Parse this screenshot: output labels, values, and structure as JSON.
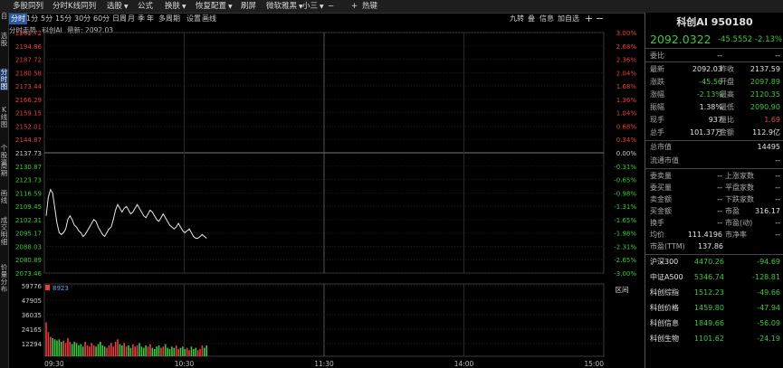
{
  "toolbar": {
    "items": [
      {
        "label": "多股同列",
        "caret": false
      },
      {
        "label": "分时K线同列",
        "caret": false
      },
      {
        "label": "选股",
        "caret": true
      },
      {
        "label": "公式",
        "caret": false
      },
      {
        "label": "换肤",
        "caret": true
      },
      {
        "label": "恢复配置",
        "caret": true
      },
      {
        "label": "刷屏",
        "caret": false
      },
      {
        "label": "微软雅黑",
        "caret": true
      },
      {
        "label": "小三",
        "caret": true
      },
      {
        "label": "热键",
        "caret": false
      }
    ],
    "minus": "−",
    "plus": "+"
  },
  "left_strip": [
    {
      "label": "自",
      "active": false
    },
    {
      "label": "选股",
      "active": false
    },
    {
      "label": "分时图",
      "active": true
    },
    {
      "label": "K线图",
      "active": false
    },
    {
      "label": "个股资",
      "active": false
    },
    {
      "label": "周期",
      "active": false
    },
    {
      "label": "画线",
      "active": false
    },
    {
      "label": "成交明细",
      "active": false
    },
    {
      "label": "价量分布",
      "active": false
    }
  ],
  "period_tabs": [
    {
      "label": "分时",
      "active": true
    },
    {
      "label": "1分",
      "active": false
    },
    {
      "label": "5分",
      "active": false
    },
    {
      "label": "15分",
      "active": false
    },
    {
      "label": "30分",
      "active": false
    },
    {
      "label": "60分",
      "active": false
    },
    {
      "label": "日",
      "active": false
    },
    {
      "label": "周",
      "active": false
    },
    {
      "label": "月",
      "active": false
    },
    {
      "label": "季",
      "active": false
    },
    {
      "label": "年",
      "active": false
    },
    {
      "label": "多周期",
      "active": false
    },
    {
      "label": "设置",
      "active": false
    },
    {
      "label": "画线",
      "active": false
    }
  ],
  "right_tabs": [
    "九转",
    "叠",
    "信息",
    "加自选"
  ],
  "chart_info": {
    "label": "分时走势",
    "name": "科创AI",
    "latest_label": "最新:",
    "latest": "2092.03"
  },
  "volume_label": "8923",
  "area_label": "区间",
  "panel": {
    "title": "科创AI 950180",
    "price": "2092.0322",
    "change": "-45.5552",
    "change_pct": "-2.13%",
    "weibi_label": "委比",
    "weibi_value": "--",
    "weibi_value2": "--",
    "quote_rows": [
      {
        "l1": "最新",
        "v1": "2092.03",
        "c1": "white",
        "l2": "昨收",
        "v2": "2137.59",
        "c2": "white"
      },
      {
        "l1": "涨跌",
        "v1": "-45.56",
        "c1": "green",
        "l2": "开盘",
        "v2": "2097.89",
        "c2": "green"
      },
      {
        "l1": "涨幅",
        "v1": "-2.13%",
        "c1": "green",
        "l2": "最高",
        "v2": "2120.35",
        "c2": "green"
      },
      {
        "l1": "振幅",
        "v1": "1.38%",
        "c1": "white",
        "l2": "最低",
        "v2": "2090.90",
        "c2": "green"
      },
      {
        "l1": "现手",
        "v1": "937",
        "c1": "white",
        "l2": "量比",
        "v2": "1.69",
        "c2": "red"
      },
      {
        "l1": "总手",
        "v1": "101.37万",
        "c1": "white",
        "l2": "金额",
        "v2": "112.9亿",
        "c2": "white"
      }
    ],
    "mv_rows": [
      {
        "l": "总市值",
        "v": "14495"
      },
      {
        "l": "流通市值",
        "v": "--"
      }
    ],
    "detail_rows": [
      {
        "l1": "委卖量",
        "v1": "--",
        "l2": "上涨家数",
        "v2": "--"
      },
      {
        "l1": "委买量",
        "v1": "--",
        "l2": "平盘家数",
        "v2": "--"
      },
      {
        "l1": "卖金额",
        "v1": "--",
        "l2": "下跌家数",
        "v2": "--"
      },
      {
        "l1": "买金额",
        "v1": "--",
        "l2": "市盈",
        "v2": "316.17"
      },
      {
        "l1": "换手",
        "v1": "--",
        "l2": "市盈(动)",
        "v2": "--"
      },
      {
        "l1": "均价",
        "v1": "111.4196",
        "l2": "市净率",
        "v2": "--"
      }
    ],
    "pe_ttm_label": "市盈(TTM)",
    "pe_ttm_value": "137.86",
    "indices": [
      {
        "name": "沪深300",
        "value": "4470.26",
        "change": "-94.69"
      },
      {
        "name": "中证A500",
        "value": "5346.74",
        "change": "-128.81"
      },
      {
        "name": "科创综指",
        "value": "1512.23",
        "change": "-49.66"
      },
      {
        "name": "科创价格",
        "value": "1459.80",
        "change": "-47.94"
      },
      {
        "name": "科创信息",
        "value": "1849.66",
        "change": "-56.09"
      },
      {
        "name": "科创生物",
        "value": "1101.62",
        "change": "-24.19"
      }
    ]
  },
  "chart_data": {
    "type": "line",
    "prev_close": 2137.59,
    "price_ticks": [
      "2201.72",
      "2194.86",
      "2187.72",
      "2180.58",
      "2173.44",
      "2166.29",
      "2159.15",
      "2152.01",
      "2144.87",
      "2137.73",
      "2130.87",
      "2123.73",
      "2116.59",
      "2109.45",
      "2102.31",
      "2095.17",
      "2088.03",
      "2080.89",
      "2073.46"
    ],
    "pct_ticks": [
      "3.00%",
      "2.68%",
      "2.36%",
      "2.04%",
      "1.68%",
      "1.36%",
      "1.04%",
      "0.68%",
      "0.34%",
      "0.00%",
      "-0.31%",
      "-0.65%",
      "-0.98%",
      "-1.31%",
      "-1.65%",
      "-1.98%",
      "-2.31%",
      "-2.65%",
      "-3.00%"
    ],
    "time_ticks": [
      "09:30",
      "10:30",
      "11:30",
      "14:00",
      "15:00"
    ],
    "volume_ticks": [
      "59776",
      "47905",
      "36035",
      "24165",
      "12294"
    ],
    "ylim": [
      2073.46,
      2201.72
    ],
    "volume_max": 59776,
    "prices": [
      2104,
      2114,
      2118,
      2116,
      2108,
      2100,
      2095,
      2094,
      2095,
      2097,
      2102,
      2104,
      2102,
      2099,
      2098,
      2096,
      2095,
      2093,
      2094,
      2096,
      2098,
      2100,
      2102,
      2101,
      2098,
      2096,
      2094,
      2093,
      2095,
      2097,
      2098,
      2102,
      2107,
      2110,
      2108,
      2106,
      2108,
      2109,
      2107,
      2105,
      2106,
      2108,
      2110,
      2108,
      2106,
      2104,
      2103,
      2105,
      2107,
      2106,
      2104,
      2102,
      2101,
      2103,
      2105,
      2103,
      2101,
      2099,
      2098,
      2097,
      2098,
      2100,
      2098,
      2096,
      2095,
      2096,
      2097,
      2095,
      2093,
      2092,
      2092,
      2093,
      2094,
      2093,
      2092
    ],
    "volumes": [
      28000,
      20000,
      16000,
      15000,
      14000,
      13000,
      14000,
      12000,
      13000,
      11000,
      15000,
      12000,
      10000,
      12000,
      11000,
      9000,
      10000,
      8000,
      12000,
      9000,
      8000,
      11000,
      9000,
      8000,
      10000,
      12000,
      9000,
      8000,
      7000,
      9000,
      11000,
      8000,
      12000,
      14000,
      10000,
      9000,
      11000,
      8000,
      9000,
      7000,
      10000,
      8000,
      9000,
      11000,
      8000,
      7000,
      9000,
      8000,
      10000,
      7000,
      6000,
      8000,
      9000,
      7000,
      8000,
      10000,
      7000,
      6000,
      8000,
      7000,
      9000,
      6000,
      7000,
      8000,
      6000,
      7000,
      5000,
      8000,
      6000,
      7000,
      5000,
      6000,
      9000,
      7000,
      8923
    ]
  }
}
